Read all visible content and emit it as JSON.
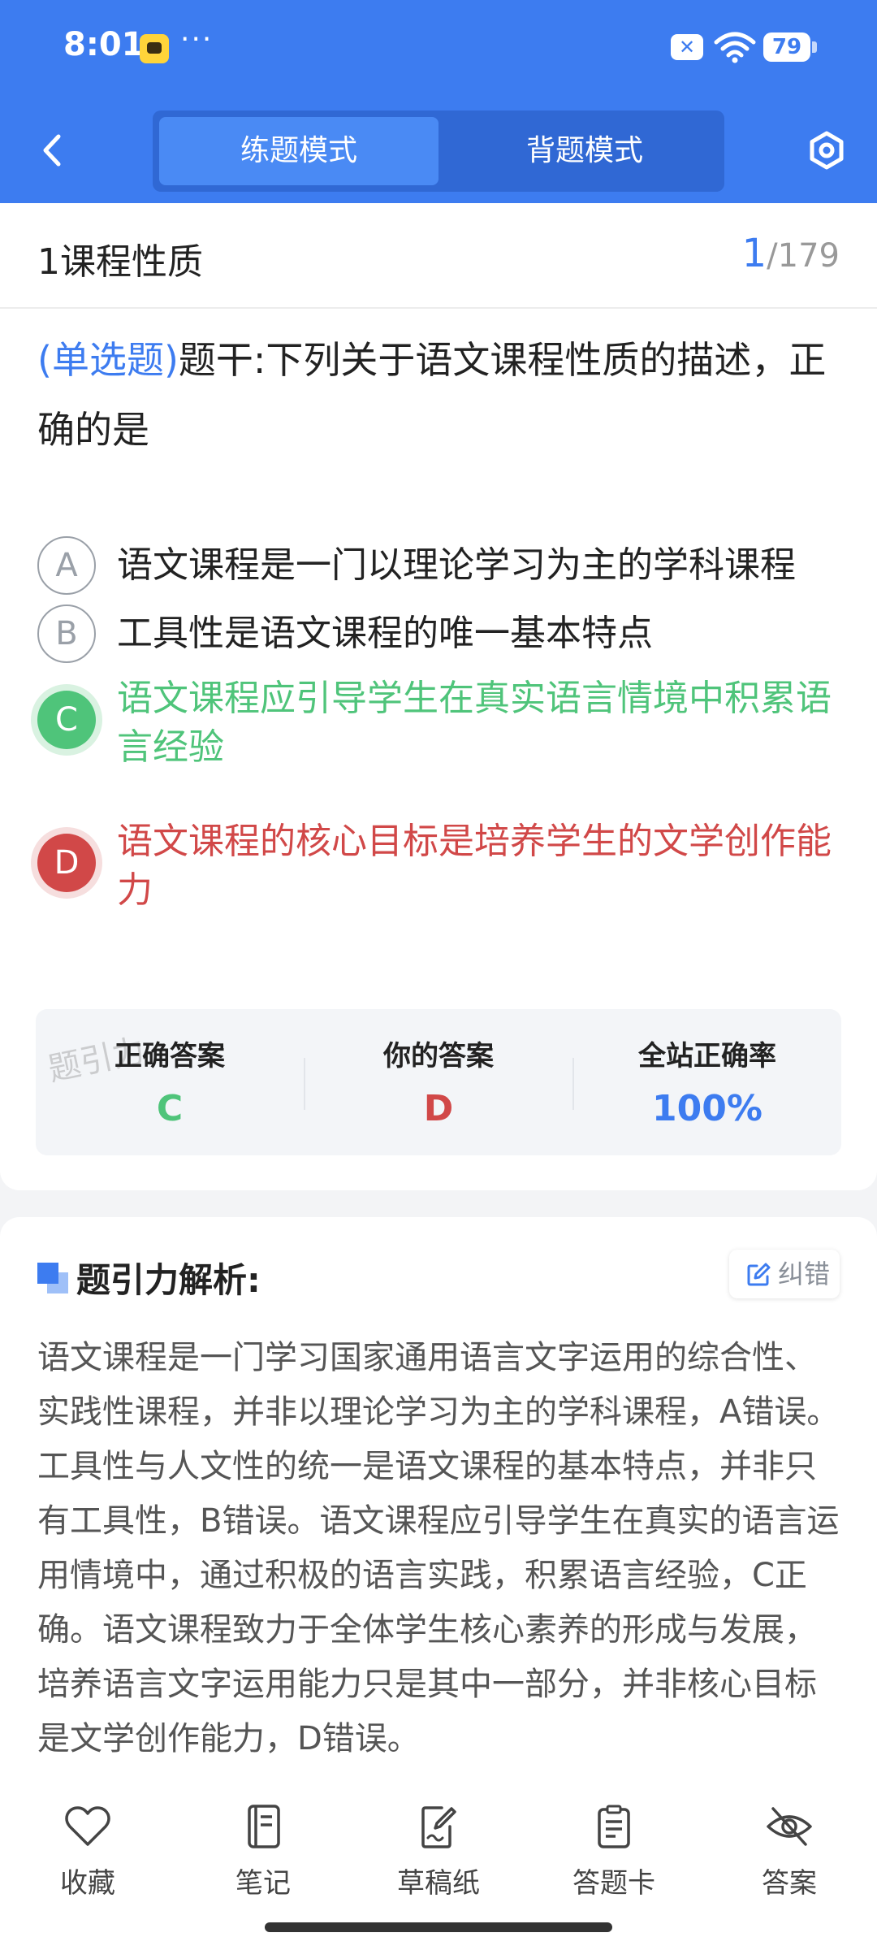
{
  "status_bar": {
    "time": "8:01",
    "more": "···",
    "battery": "79"
  },
  "header": {
    "tabs": [
      {
        "label": "练题模式",
        "active": true
      },
      {
        "label": "背题模式",
        "active": false
      }
    ],
    "accent_color": "#3d7cf0"
  },
  "question": {
    "chapter": "1课程性质",
    "current": "1",
    "total": "/179",
    "type": "(单选题)",
    "stem": "题干:下列关于语文课程性质的描述，正确的是",
    "options": [
      {
        "letter": "A",
        "text": "语文课程是一门以理论学习为主的学科课程",
        "state": "normal"
      },
      {
        "letter": "B",
        "text": "工具性是语文课程的唯一基本特点",
        "state": "normal"
      },
      {
        "letter": "C",
        "text": "语文课程应引导学生在真实语言情境中积累语言经验",
        "state": "correct"
      },
      {
        "letter": "D",
        "text": "语文课程的核心目标是培养学生的文学创作能力",
        "state": "wrong"
      }
    ]
  },
  "answer_panel": {
    "watermark": "题引力",
    "correct_label": "正确答案",
    "correct_value": "C",
    "yours_label": "你的答案",
    "yours_value": "D",
    "rate_label": "全站正确率",
    "rate_value": "100%"
  },
  "explanation": {
    "title": "题引力解析:",
    "report_label": "纠错",
    "text": "语文课程是一门学习国家通用语言文字运用的综合性、实践性课程，并非以理论学习为主的学科课程，A错误。工具性与人文性的统一是语文课程的基本特点，并非只有工具性，B错误。语文课程应引导学生在真实的语言运用情境中，通过积极的语言实践，积累语言经验，C正确。语文课程致力于全体学生核心素养的形成与发展，培养语言文字运用能力只是其中一部分，并非核心目标是文学创作能力，D错误。"
  },
  "bottom_nav": {
    "items": [
      {
        "label": "收藏",
        "icon": "heart-icon"
      },
      {
        "label": "笔记",
        "icon": "notebook-icon"
      },
      {
        "label": "草稿纸",
        "icon": "draft-paper-icon"
      },
      {
        "label": "答题卡",
        "icon": "answer-sheet-icon"
      },
      {
        "label": "答案",
        "icon": "eye-off-icon"
      }
    ]
  }
}
